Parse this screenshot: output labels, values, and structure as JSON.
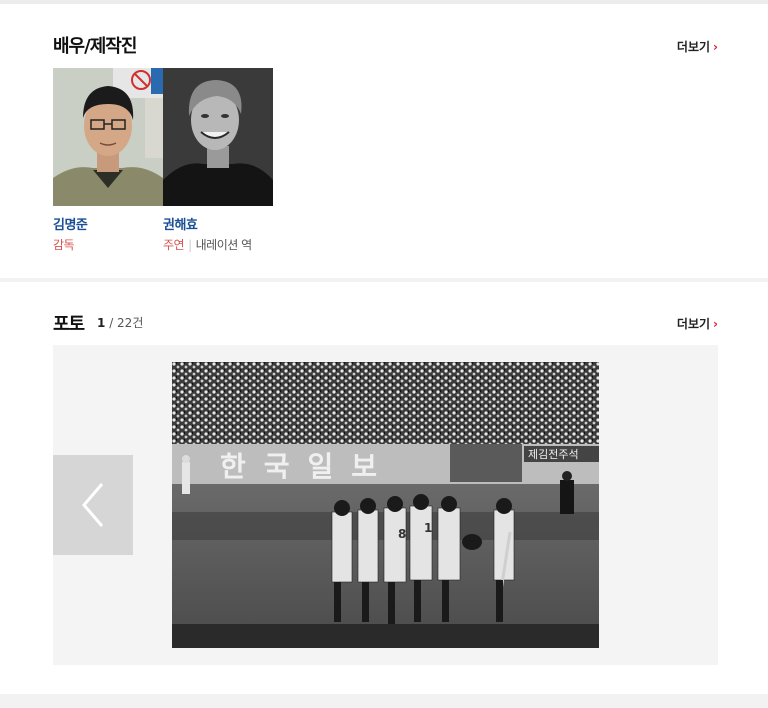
{
  "colors": {
    "accent": "#e0203a",
    "name_link": "#1a4f95",
    "role_type": "#d9544d"
  },
  "cast_section": {
    "title": "배우/제작진",
    "more_label": "더보기",
    "more_icon": "chevron-right-icon",
    "people": [
      {
        "name": "김명준",
        "role_type": "감독",
        "role_name": ""
      },
      {
        "name": "권해효",
        "role_type": "주연",
        "role_name": "내레이션 역"
      }
    ]
  },
  "photo_section": {
    "title": "포토",
    "current": "1",
    "total": "/ 22건",
    "more_label": "더보기",
    "prev_icon": "chevron-left-icon",
    "photo_sign_text": "한국일보",
    "photo_sign_right": "제김전주석"
  }
}
